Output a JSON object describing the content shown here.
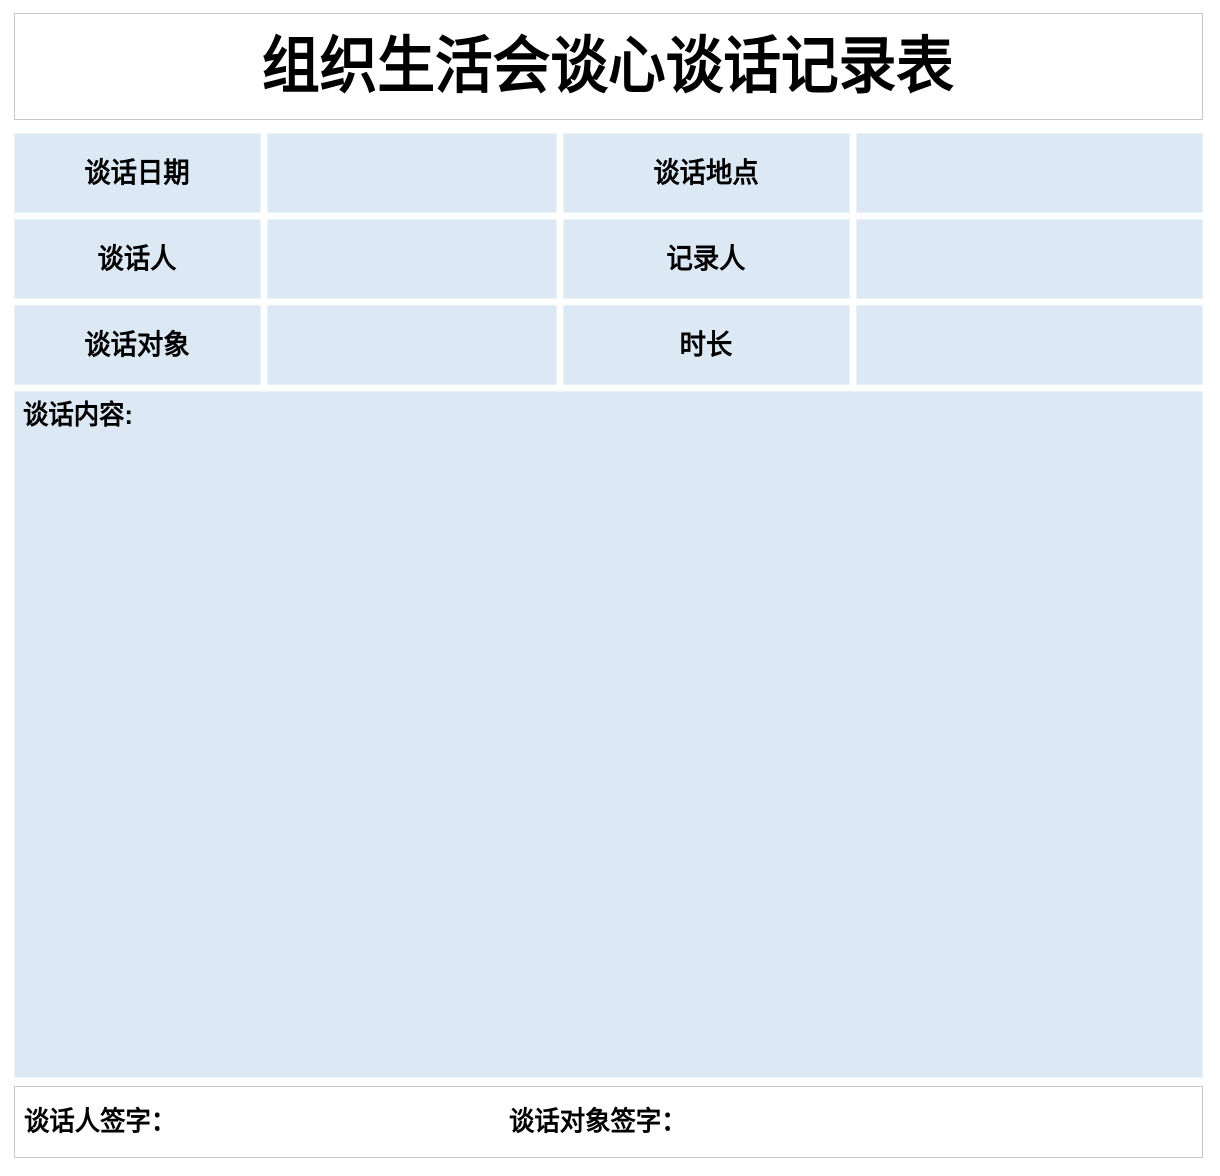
{
  "document": {
    "title": "组织生活会谈心谈话记录表"
  },
  "info_rows": [
    {
      "label_left": "谈话日期",
      "value_left": "",
      "label_right": "谈话地点",
      "value_right": ""
    },
    {
      "label_left": "谈话人",
      "value_left": "",
      "label_right": "记录人",
      "value_right": ""
    },
    {
      "label_left": "谈话对象",
      "value_left": "",
      "label_right": "时长",
      "value_right": ""
    }
  ],
  "content": {
    "label": "谈话内容:",
    "text": ""
  },
  "signatures": {
    "interviewer_label": "谈话人签字：",
    "interviewee_label": "谈话对象签字："
  },
  "colors": {
    "cell_fill": "#dce8f4",
    "cell_border": "#eaf1f8",
    "outer_border": "#c9c9c9",
    "page_background": "#ffffff",
    "text": "#000000"
  }
}
